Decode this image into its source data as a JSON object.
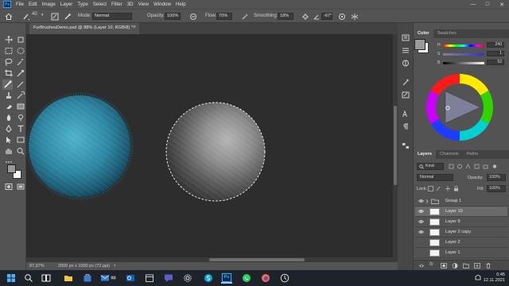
{
  "menubar": {
    "logo": "Ps",
    "items": [
      "File",
      "Edit",
      "Image",
      "Layer",
      "Type",
      "Select",
      "Filter",
      "3D",
      "View",
      "Window",
      "Help"
    ],
    "window_controls": [
      "—",
      "□",
      "✕"
    ]
  },
  "options": {
    "brush_size": "40",
    "mode_label": "Mode:",
    "mode_value": "Normal",
    "opacity_label": "Opacity:",
    "opacity_value": "100%",
    "flow_label": "Flow:",
    "flow_value": "70%",
    "smoothing_label": "Smoothing:",
    "smoothing_value": "18%",
    "angle_value": "-67°"
  },
  "document": {
    "tab_title": "FurBrushesDemo.psd @ 88% (Layer 10, RGB/8) *",
    "close": "×"
  },
  "status": {
    "zoom": "87,97%",
    "dimensions": "2000 px x 1000 px (72 ppi)",
    "arrow": "›"
  },
  "color_panel": {
    "tabs": [
      "Color",
      "Swatches"
    ],
    "h_label": "H",
    "h_value": "240",
    "s_label": "S",
    "s_value": "1",
    "b_label": "B",
    "b_value": "52",
    "colors": {
      "foreground": "#9a9a9a",
      "background": "#ffffff",
      "accent": "#2f7fd8"
    }
  },
  "layers_panel": {
    "tabs": [
      "Layers",
      "Channels",
      "Paths"
    ],
    "kind_label": "Kind",
    "blend_mode": "Normal",
    "opacity_label": "Opacity:",
    "opacity_value": "100%",
    "lock_label": "Lock:",
    "fill_label": "Fill:",
    "fill_value": "100%",
    "layers": [
      {
        "name": "Group 1",
        "type": "group",
        "selected": false
      },
      {
        "name": "Layer 10",
        "type": "layer",
        "selected": true
      },
      {
        "name": "Layer 9",
        "type": "layer",
        "selected": false
      },
      {
        "name": "Layer 2 copy",
        "type": "layer",
        "selected": false
      },
      {
        "name": "Layer 2",
        "type": "layer",
        "selected": false
      },
      {
        "name": "Layer 1",
        "type": "layer",
        "selected": false
      }
    ],
    "footer_fx": "fx"
  },
  "taskbar": {
    "time": "0:45",
    "date": "12.11.2021",
    "mail_badge": "63",
    "ps_label": "Ps"
  }
}
